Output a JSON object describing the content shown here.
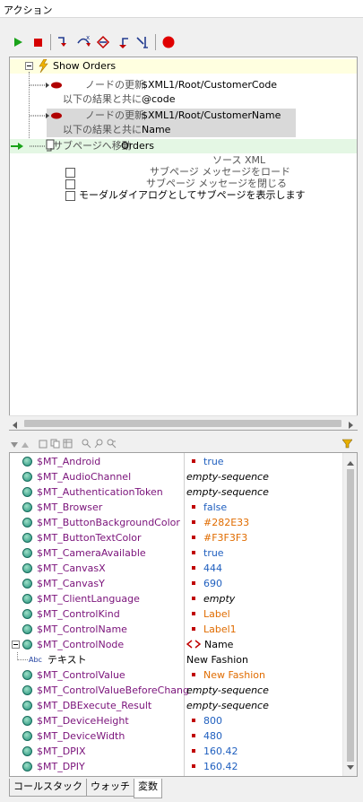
{
  "title": "アクション",
  "toolbar": {
    "buttons": [
      "play-icon",
      "stop-icon",
      "step-into-icon",
      "step-over-icon",
      "step-out-icon",
      "step-back-icon",
      "run-to-cursor-icon",
      "breakpoint-icon"
    ]
  },
  "actions": {
    "group_title": "Show Orders",
    "rows": [
      {
        "label": "ノードの更新",
        "value": "$XML1/Root/CustomerCode"
      },
      {
        "label": "以下の結果と共に",
        "value": "@code"
      },
      {
        "label": "ノードの更新",
        "value": "$XML1/Root/CustomerName"
      },
      {
        "label": "以下の結果と共に",
        "value": "Name"
      },
      {
        "label": "サブページへ移動",
        "value": "Orders"
      }
    ],
    "source_label": "ソース XML",
    "options": [
      "サブページ メッセージをロード",
      "サブページ メッセージを閉じる",
      "モーダルダイアログとしてサブページを表示します"
    ]
  },
  "variables": [
    {
      "name": "$MT_Android",
      "value": "true",
      "bullet": "#c00000",
      "color": "#1f5fbf",
      "italic": false
    },
    {
      "name": "$MT_AudioChannel",
      "value": "empty-sequence",
      "bullet": "",
      "color": "#000000",
      "italic": true
    },
    {
      "name": "$MT_AuthenticationToken",
      "value": "empty-sequence",
      "bullet": "",
      "color": "#000000",
      "italic": true
    },
    {
      "name": "$MT_Browser",
      "value": "false",
      "bullet": "#c00000",
      "color": "#1f5fbf",
      "italic": false
    },
    {
      "name": "$MT_ButtonBackgroundColor",
      "value": "#282E33",
      "bullet": "#c00000",
      "color": "#e06c00",
      "italic": false
    },
    {
      "name": "$MT_ButtonTextColor",
      "value": "#F3F3F3",
      "bullet": "#c00000",
      "color": "#e06c00",
      "italic": false
    },
    {
      "name": "$MT_CameraAvailable",
      "value": "true",
      "bullet": "#c00000",
      "color": "#1f5fbf",
      "italic": false
    },
    {
      "name": "$MT_CanvasX",
      "value": "444",
      "bullet": "#c00000",
      "color": "#1f5fbf",
      "italic": false
    },
    {
      "name": "$MT_CanvasY",
      "value": "690",
      "bullet": "#c00000",
      "color": "#1f5fbf",
      "italic": false
    },
    {
      "name": "$MT_ClientLanguage",
      "value": "empty",
      "bullet": "#c00000",
      "color": "#000000",
      "italic": true
    },
    {
      "name": "$MT_ControlKind",
      "value": "Label",
      "bullet": "#c00000",
      "color": "#e06c00",
      "italic": false
    },
    {
      "name": "$MT_ControlName",
      "value": "Label1",
      "bullet": "#c00000",
      "color": "#e06c00",
      "italic": false
    },
    {
      "name": "$MT_ControlNode",
      "value": "Name",
      "bullet": "",
      "color": "#000000",
      "italic": false,
      "node": true
    },
    {
      "name": "テキスト",
      "value": "New Fashion",
      "bullet": "",
      "color": "#000000",
      "italic": false,
      "child": true
    },
    {
      "name": "$MT_ControlValue",
      "value": "New Fashion",
      "bullet": "#c00000",
      "color": "#e06c00",
      "italic": false
    },
    {
      "name": "$MT_ControlValueBeforeChang",
      "value": "empty-sequence",
      "bullet": "",
      "color": "#000000",
      "italic": true
    },
    {
      "name": "$MT_DBExecute_Result",
      "value": "empty-sequence",
      "bullet": "",
      "color": "#000000",
      "italic": true
    },
    {
      "name": "$MT_DeviceHeight",
      "value": "800",
      "bullet": "#c00000",
      "color": "#1f5fbf",
      "italic": false
    },
    {
      "name": "$MT_DeviceWidth",
      "value": "480",
      "bullet": "#c00000",
      "color": "#1f5fbf",
      "italic": false
    },
    {
      "name": "$MT_DPIX",
      "value": "160.42",
      "bullet": "#c00000",
      "color": "#1f5fbf",
      "italic": false
    },
    {
      "name": "$MT_DPIY",
      "value": "160.42",
      "bullet": "#c00000",
      "color": "#1f5fbf",
      "italic": false
    }
  ],
  "tabs": [
    "コールスタック",
    "ウォッチ",
    "変数"
  ],
  "colors": {
    "var_name": "#7a127a",
    "highlight_green": "#e4f7e4",
    "highlight_yellow": "#ffffe0",
    "highlight_gray": "#d9d9d9"
  }
}
